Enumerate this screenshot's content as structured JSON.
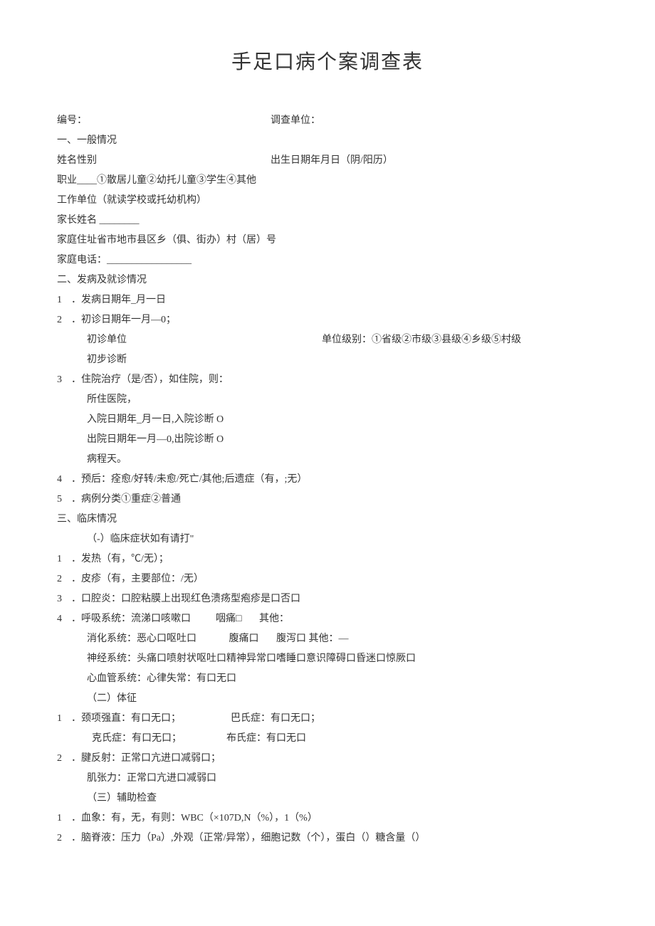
{
  "title": "手足口病个案调查表",
  "header": {
    "id_label": "编号：",
    "unit_label": "调查单位："
  },
  "sec1": {
    "title": "一、一般情况",
    "name_gender": "姓名性别",
    "dob": "出生日期年月日（阴/阳历）",
    "occupation": "职业____①散居儿童②幼托儿童③学生④其他",
    "work_unit": "工作单位（就读学校或托幼机构）",
    "parent": "家长姓名 ________",
    "address": "家庭住址省市地市县区乡（俱、街办）村（居）号",
    "phone": "家庭电话：_________________"
  },
  "sec2": {
    "title": "二、发病及就诊情况",
    "i1": "．发病日期年_月一日",
    "i2": "．初诊日期年一月—0；",
    "i2a": "初诊单位",
    "i2b": "单位级别：①省级②市级③县级④乡级⑤村级",
    "i2c": "初步诊断",
    "i3": "．住院治疗（是/否），如住院，则：",
    "i3a": "所住医院，",
    "i3b": "入院日期年_月一日,入院诊断 O",
    "i3c": "出院日期年一月—0,出院诊断 O",
    "i3d": "病程天。",
    "i4": "．预后：痊愈/好转/未愈/死亡/其他;后遗症（有，;无）",
    "i5": "．病例分类①重症②普通"
  },
  "sec3": {
    "title": "三、临床情况",
    "sub1": "（-）临床症状如有请打\"",
    "i1": "．发热（有，℃/无）；",
    "i2": "．皮疹（有，主要部位：/无）",
    "i3": "．口腔炎：口腔粘膜上出现红色溃疡型疱疹是口否口",
    "i4": "．呼吸系统：流涕口咳嗽口          咽痛□       其他：",
    "i4a": "消化系统：恶心口呕吐口             腹痛口       腹泻口 其他：—",
    "i4b": "神经系统：头痛口喷射状呕吐口精神异常口嗜睡口意识障碍口昏迷口惊厥口",
    "i4c": "心血管系统：心律失常：有口无口",
    "sub2": "（二）体征",
    "s1": "．颈项强直：有口无口；                    巴氏症：有口无口；",
    "s1a": "  克氏症：有口无口；                  布氏症：有口无口",
    "s2": "．腱反射：正常口亢进口减弱口；",
    "s2a": "肌张力：正常口亢进口减弱口",
    "sub3": "（三）辅助检查",
    "a1": "．血象：有，无，有则：WBC（×107D,N（%），1（%）",
    "a2": "．脑脊液：压力（Pa）,外观（正常/异常），细胞记数（个），蛋白（）糖含量（）"
  }
}
